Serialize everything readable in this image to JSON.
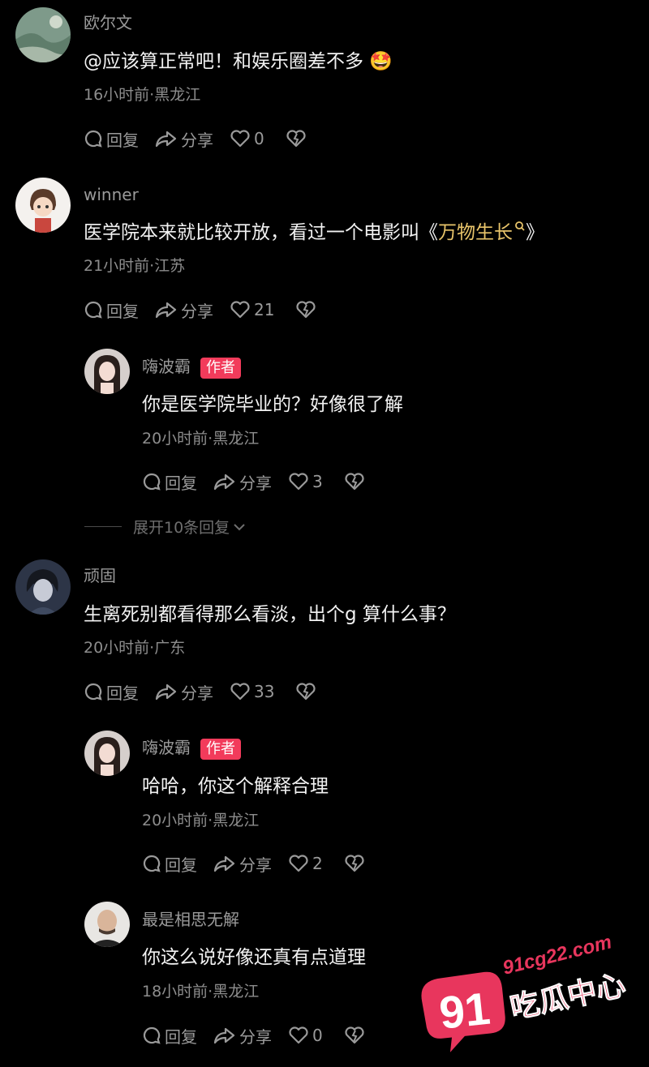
{
  "comments": [
    {
      "name": "欧尔文",
      "text": "@应该算正常吧！和娱乐圈差不多 🤩",
      "meta": "16小时前·黑龙江",
      "reply": "回复",
      "share": "分享",
      "likes": "0"
    },
    {
      "name": "winner",
      "text_pre": "医学院本来就比较开放，看过一个电影叫《",
      "text_link": "万物生长",
      "text_post": "》",
      "meta": "21小时前·江苏",
      "reply": "回复",
      "share": "分享",
      "likes": "21",
      "replies": [
        {
          "name": "嗨波霸",
          "badge": "作者",
          "text": "你是医学院毕业的？好像很了解",
          "meta": "20小时前·黑龙江",
          "reply": "回复",
          "share": "分享",
          "likes": "3"
        }
      ],
      "expand_label": "展开10条回复"
    },
    {
      "name": "顽固",
      "text": "生离死别都看得那么看淡，出个g 算什么事？",
      "meta": "20小时前·广东",
      "reply": "回复",
      "share": "分享",
      "likes": "33",
      "replies": [
        {
          "name": "嗨波霸",
          "badge": "作者",
          "text": "哈哈，你这个解释合理",
          "meta": "20小时前·黑龙江",
          "reply": "回复",
          "share": "分享",
          "likes": "2"
        },
        {
          "name": "最是相思无解",
          "text": "你这么说好像还真有点道理",
          "meta": "18小时前·黑龙江",
          "reply": "回复",
          "share": "分享",
          "likes": "0"
        }
      ]
    }
  ],
  "watermark": {
    "url": "91cg22.com",
    "number": "91",
    "label": "吃瓜中心"
  },
  "colors": {
    "background": "#000000",
    "badge": "#f23b5b",
    "link": "#e8c46a",
    "watermark": "#e8365d"
  }
}
